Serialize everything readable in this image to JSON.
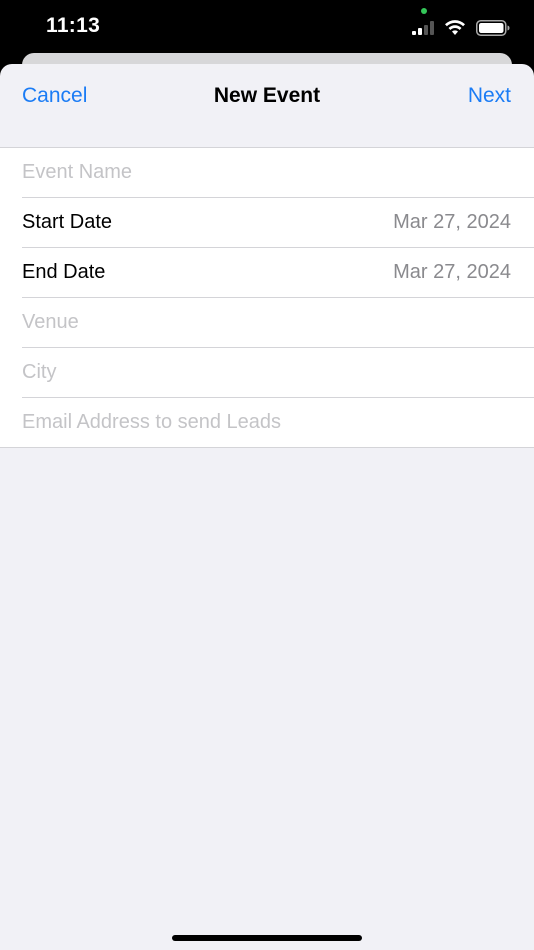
{
  "status_bar": {
    "time": "11:13"
  },
  "nav": {
    "cancel_label": "Cancel",
    "title": "New Event",
    "next_label": "Next"
  },
  "form": {
    "event_name_placeholder": "Event Name",
    "start_date_label": "Start Date",
    "start_date_value": "Mar 27, 2024",
    "end_date_label": "End Date",
    "end_date_value": "Mar 27, 2024",
    "venue_placeholder": "Venue",
    "city_placeholder": "City",
    "email_placeholder": "Email Address to send Leads"
  },
  "colors": {
    "accent": "#1b7cf5",
    "background": "#f1f1f6",
    "placeholder": "#c4c4c7",
    "secondary_text": "#8a8a8e"
  }
}
